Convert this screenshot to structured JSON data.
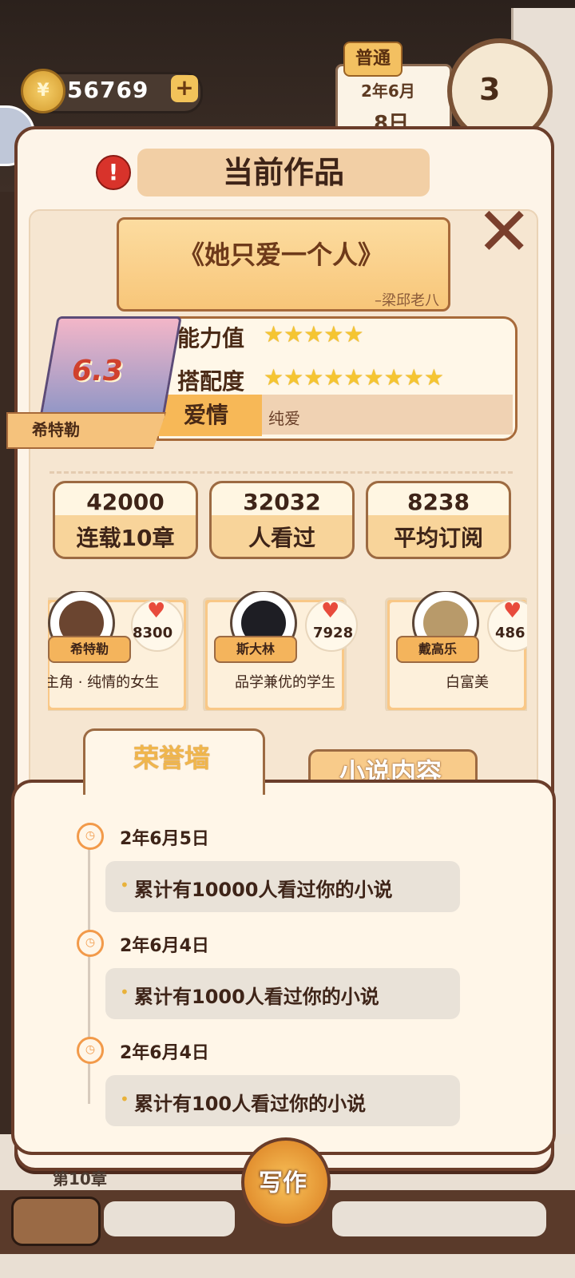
{
  "hud": {
    "coins": "56769",
    "coin_symbol": "¥",
    "plus": "+",
    "difficulty": "普通",
    "calendar_date": "2年6月",
    "calendar_day": "8日",
    "clock_hand_value": "3"
  },
  "panel": {
    "title": "当前作品",
    "alert": "!",
    "close": "✕"
  },
  "book": {
    "title": "《她只爱一个人》",
    "author": "–梁邱老八",
    "score": "6.3",
    "protagonist": "希特勒",
    "ability_label": "能力值",
    "ability_stars": "★★★★★",
    "match_label": "搭配度",
    "match_stars": "★★★★★★★★★",
    "genre": "爱情",
    "subgenre": "纯爱"
  },
  "metrics": [
    {
      "value": "42000",
      "label": "连载10章"
    },
    {
      "value": "32032",
      "label": "人看过"
    },
    {
      "value": "8238",
      "label": "平均订阅"
    }
  ],
  "characters": [
    {
      "name": "希特勒",
      "likes": "8300",
      "desc": "主角 · 纯情的女生",
      "hair": "#6b4530"
    },
    {
      "name": "斯大林",
      "likes": "7928",
      "desc": "品学兼优的学生",
      "hair": "#1e1e24"
    },
    {
      "name": "戴高乐",
      "likes": "486",
      "desc": "白富美",
      "hair": "#b89a6a"
    }
  ],
  "tabs": {
    "active": "荣誉墙",
    "inactive": "小说内容"
  },
  "honor": [
    {
      "date": "2年6月5日",
      "text": "累计有10000人看过你的小说"
    },
    {
      "date": "2年6月4日",
      "text": "累计有1000人看过你的小说"
    },
    {
      "date": "2年6月4日",
      "text": "累计有100人看过你的小说"
    }
  ],
  "bottom": {
    "chapter": "第10章",
    "write": "写作"
  },
  "icons": {
    "heart": "♥",
    "clock": "◷",
    "dot": "•"
  }
}
